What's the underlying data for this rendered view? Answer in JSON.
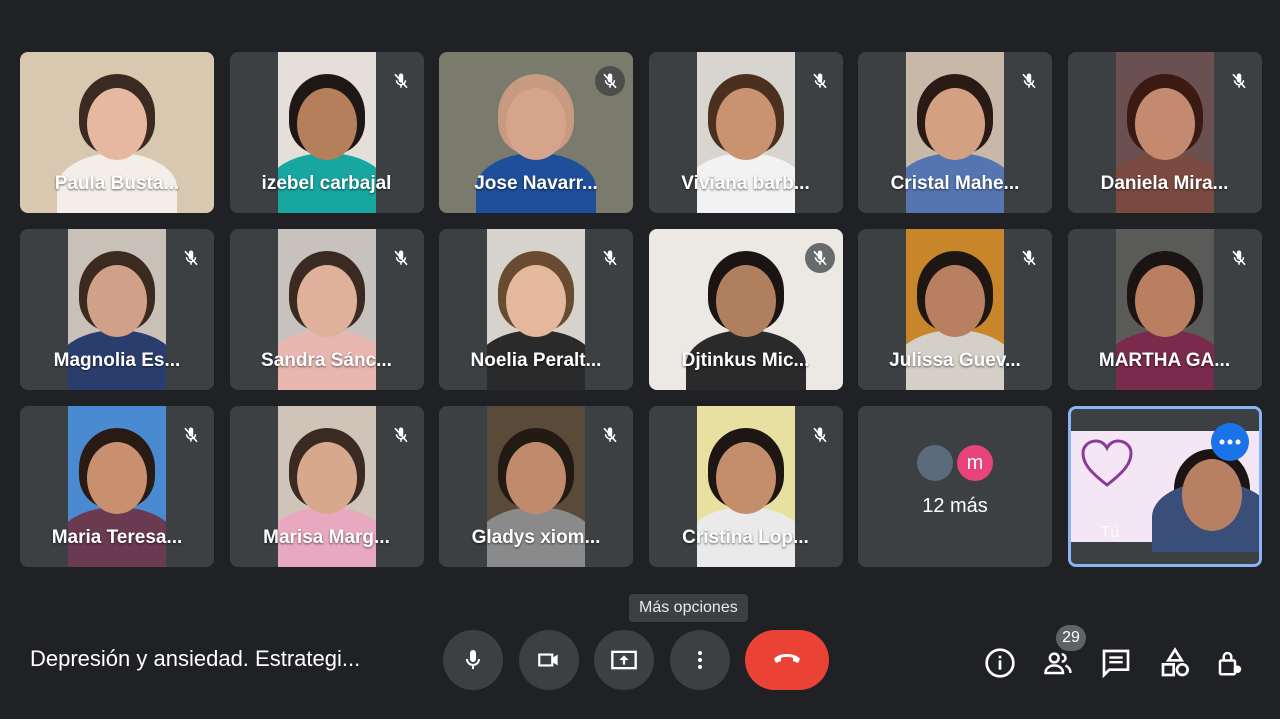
{
  "participants": [
    {
      "name": "Paula Busta...",
      "muted": false,
      "bg": "#d9c8b0",
      "skin": "#e6b8a0",
      "hair": "#3a2a22",
      "shirt": "#f3efe8",
      "full": true
    },
    {
      "name": "izebel carbajal",
      "muted": true,
      "bg": "#e4e0d9",
      "skin": "#b57f5c",
      "hair": "#1d1715",
      "shirt": "#17a6a0",
      "full": false
    },
    {
      "name": "Jose Navarr...",
      "muted": true,
      "bg": "#7a7a6d",
      "skin": "#d6a48a",
      "hair": "#c89a80",
      "shirt": "#1f4e9a",
      "full": true
    },
    {
      "name": "Viviana barb...",
      "muted": true,
      "bg": "#d8d4cf",
      "skin": "#c99370",
      "hair": "#4b3020",
      "shirt": "#f2f2f2",
      "full": false
    },
    {
      "name": "Cristal Mahe...",
      "muted": true,
      "bg": "#c8b8a8",
      "skin": "#d4a082",
      "hair": "#2a1a15",
      "shirt": "#5575b0",
      "full": false
    },
    {
      "name": "Daniela Mira...",
      "muted": true,
      "bg": "#6a5050",
      "skin": "#c48a70",
      "hair": "#3a1a12",
      "shirt": "#7a4a40",
      "full": false
    },
    {
      "name": "Magnolia Es...",
      "muted": true,
      "bg": "#c9c0b8",
      "skin": "#d0a088",
      "hair": "#3a2a20",
      "shirt": "#2a3e6e",
      "full": false
    },
    {
      "name": "Sandra Sánc...",
      "muted": true,
      "bg": "#c7c2bd",
      "skin": "#dfb09a",
      "hair": "#3a2a22",
      "shirt": "#e8b8b0",
      "full": false
    },
    {
      "name": "Noelia Peralt...",
      "muted": true,
      "bg": "#d6d2cc",
      "skin": "#e4b89c",
      "hair": "#6a4a30",
      "shirt": "#2a2a2a",
      "full": false
    },
    {
      "name": "Djtinkus Mic...",
      "muted": true,
      "bg": "#ece9e4",
      "skin": "#b0805e",
      "hair": "#1a1412",
      "shirt": "#2a2a2a",
      "full": true
    },
    {
      "name": "Julissa Guev...",
      "muted": true,
      "bg": "#c8852a",
      "skin": "#b88060",
      "hair": "#1e1612",
      "shirt": "#d4d0c8",
      "full": false
    },
    {
      "name": "MARTHA GA...",
      "muted": true,
      "bg": "#5a5a58",
      "skin": "#b88060",
      "hair": "#1a1412",
      "shirt": "#7a2a4a",
      "full": false
    },
    {
      "name": "Maria Teresa...",
      "muted": true,
      "bg": "#4a8ad0",
      "skin": "#c8906e",
      "hair": "#2a1a14",
      "shirt": "#6a3a50",
      "full": false
    },
    {
      "name": "Marisa Marg...",
      "muted": true,
      "bg": "#d0c4b8",
      "skin": "#d8a88c",
      "hair": "#3a2a22",
      "shirt": "#e8a8c0",
      "full": false
    },
    {
      "name": "Gladys xiom...",
      "muted": true,
      "bg": "#5a4a3a",
      "skin": "#c08a6c",
      "hair": "#241a14",
      "shirt": "#8a8a8a",
      "full": false
    },
    {
      "name": "Cristina Lop...",
      "muted": true,
      "bg": "#e8e0a0",
      "skin": "#c48e6c",
      "hair": "#1e1612",
      "shirt": "#eaeaea",
      "full": false
    }
  ],
  "more": {
    "count_label": "12 más",
    "avatar_letter": "m",
    "avatar_color": "#e8437a"
  },
  "self": {
    "label": "Tú",
    "bg": "#f4e6f4",
    "skin": "#b88062",
    "hair": "#1a1412",
    "shirt": "#3a4e7a"
  },
  "tooltip": "Más opciones",
  "meeting_title": "Depresión y ansiedad. Estrategi...",
  "participants_count": "29",
  "controls": [
    "microphone",
    "camera",
    "present-screen",
    "more-options",
    "end-call"
  ],
  "right_controls": [
    "info",
    "people",
    "chat",
    "activities",
    "host-controls"
  ],
  "colors": {
    "end_call": "#ea4335",
    "self_border": "#8ab4f8",
    "accent": "#1a73e8"
  }
}
